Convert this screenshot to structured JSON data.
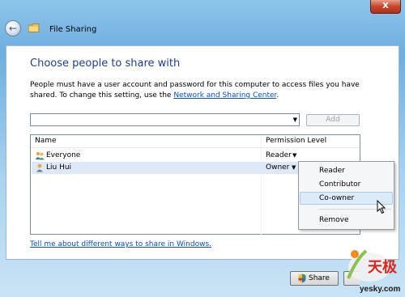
{
  "window": {
    "title": "File Sharing",
    "close_label": "X"
  },
  "heading": "Choose people to share with",
  "description": {
    "text": "People must have a user account and password for this computer to access files you have shared.  To change this setting, use the ",
    "link": "Network and Sharing Center",
    "end": "."
  },
  "input": {
    "value": "",
    "add_label": "Add"
  },
  "table": {
    "headers": {
      "name": "Name",
      "permission": "Permission Level"
    },
    "rows": [
      {
        "name": "Everyone",
        "permission": "Reader",
        "icon": "users-group-icon"
      },
      {
        "name": "Liu Hui",
        "permission": "Owner",
        "icon": "user-icon"
      }
    ]
  },
  "menu": {
    "items": [
      "Reader",
      "Contributor",
      "Co-owner",
      "Remove"
    ],
    "highlighted": "Co-owner"
  },
  "help_link": "Tell me about different ways to share in Windows.",
  "buttons": {
    "share": "Share"
  },
  "watermark": {
    "logo_text": "天极",
    "site": "yesky.com"
  },
  "colors": {
    "heading": "#1e3e91",
    "link": "#0b4ec5",
    "selection": "#dde9f6",
    "menu_highlight": "#dcebf9"
  }
}
